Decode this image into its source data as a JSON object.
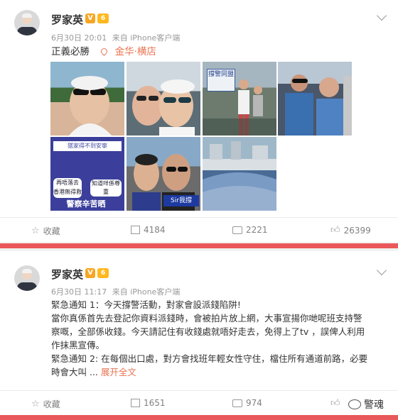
{
  "post1": {
    "author": "罗家英",
    "time": "6月30日 20:01",
    "source": "来自 iPhone客户端",
    "text": "正義必勝",
    "location": "金华·横店",
    "photos": [
      {
        "icon": "selfie-photo"
      },
      {
        "icon": "selfie-photo"
      },
      {
        "icon": "crowd-photo",
        "sign": "撐警同盟"
      },
      {
        "icon": "people-photo"
      },
      {
        "icon": "poster-photo",
        "lines": [
          "㺊家得不到安寧",
          "再唔落去",
          "香港無得救",
          "知道咩係尊重",
          "警察辛苦晒"
        ]
      },
      {
        "icon": "selfie-photo",
        "sign": "Sir我撐"
      },
      {
        "icon": "aerial-crowd-photo"
      }
    ],
    "actions": {
      "favorite": "收藏",
      "repost": "4184",
      "comment": "2221",
      "like": "26399"
    }
  },
  "post2": {
    "author": "罗家英",
    "time": "6月30日 11:17",
    "source": "来自 iPhone客户端",
    "lines": [
      "緊急通知 1：今天撐警活動，對家會設派錢陷阱!",
      "當你真係首先去登記你資料派錢時，會被拍片放上網，大事宣揚你哋呢班支持警",
      "察嘅，全部係收錢。今天請記住有收錢處就唔好走去，免得上了tv ，誤俾人利用",
      "作抹黑宣傳。",
      "緊急通知 2: 在每個出口處，對方會找班年輕女性守住，檔住所有通道前路，必要",
      "時會大叫 ..."
    ],
    "more_link": "展开全文",
    "actions": {
      "favorite": "收藏",
      "repost": "1651",
      "comment": "974"
    }
  },
  "badges": {
    "verified": "V",
    "vip": "6"
  },
  "watermark": "警魂",
  "colors": {
    "accent": "#eb7350",
    "separator": "#e9585a",
    "badge": "#f6a623"
  }
}
